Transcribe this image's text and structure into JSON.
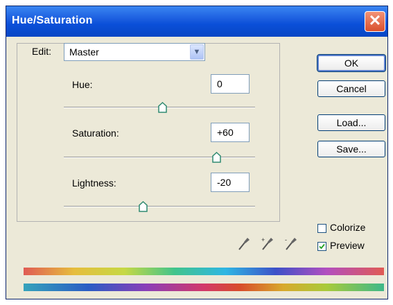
{
  "window": {
    "title": "Hue/Saturation",
    "close_glyph": "✕"
  },
  "edit": {
    "label": "Edit:",
    "value": "Master"
  },
  "sliders": {
    "hue": {
      "label": "Hue:",
      "value": "0"
    },
    "saturation": {
      "label": "Saturation:",
      "value": "+60"
    },
    "lightness": {
      "label": "Lightness:",
      "value": "-20"
    }
  },
  "buttons": {
    "ok": "OK",
    "cancel": "Cancel",
    "load": "Load...",
    "save": "Save..."
  },
  "checkboxes": {
    "colorize": {
      "label": "Colorize",
      "checked": false
    },
    "preview": {
      "label": "Preview",
      "checked": true
    }
  },
  "icons": [
    "eyedropper-icon",
    "eyedropper-plus-icon",
    "eyedropper-minus-icon"
  ],
  "colors": {
    "titlebar": "#0a4fd8",
    "face": "#ece9d8",
    "thumb": "#2f8a70"
  }
}
